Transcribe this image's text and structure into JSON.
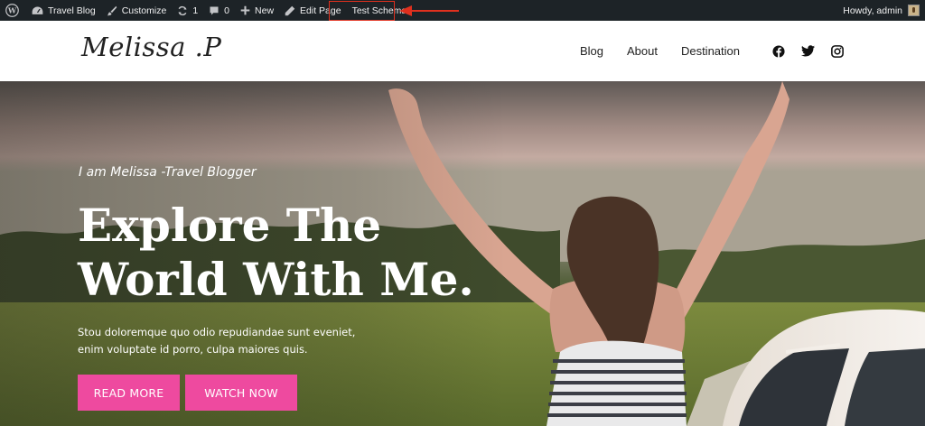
{
  "admin_bar": {
    "site_name": "Travel Blog",
    "customize": "Customize",
    "updates_count": "1",
    "comments_count": "0",
    "new": "New",
    "edit_page": "Edit Page",
    "test_schema": "Test Schema",
    "howdy": "Howdy, admin"
  },
  "header": {
    "logo_text": "Melissa .P",
    "nav": [
      "Blog",
      "About",
      "Destination"
    ],
    "social_icons": [
      "facebook-icon",
      "twitter-icon",
      "instagram-icon"
    ]
  },
  "hero": {
    "subtitle": "I am Melissa -Travel Blogger",
    "title_line1": "Explore The",
    "title_line2": "World With Me.",
    "description_line1": "Stou doloremque quo odio repudiandae sunt eveniet,",
    "description_line2": "enim voluptate id porro, culpa maiores quis.",
    "read_more": "READ MORE",
    "watch_now": "WATCH NOW"
  },
  "colors": {
    "admin_bar_bg": "#1d2327",
    "button_pink": "#ee4a9f",
    "annotation_red": "#e0301e"
  }
}
